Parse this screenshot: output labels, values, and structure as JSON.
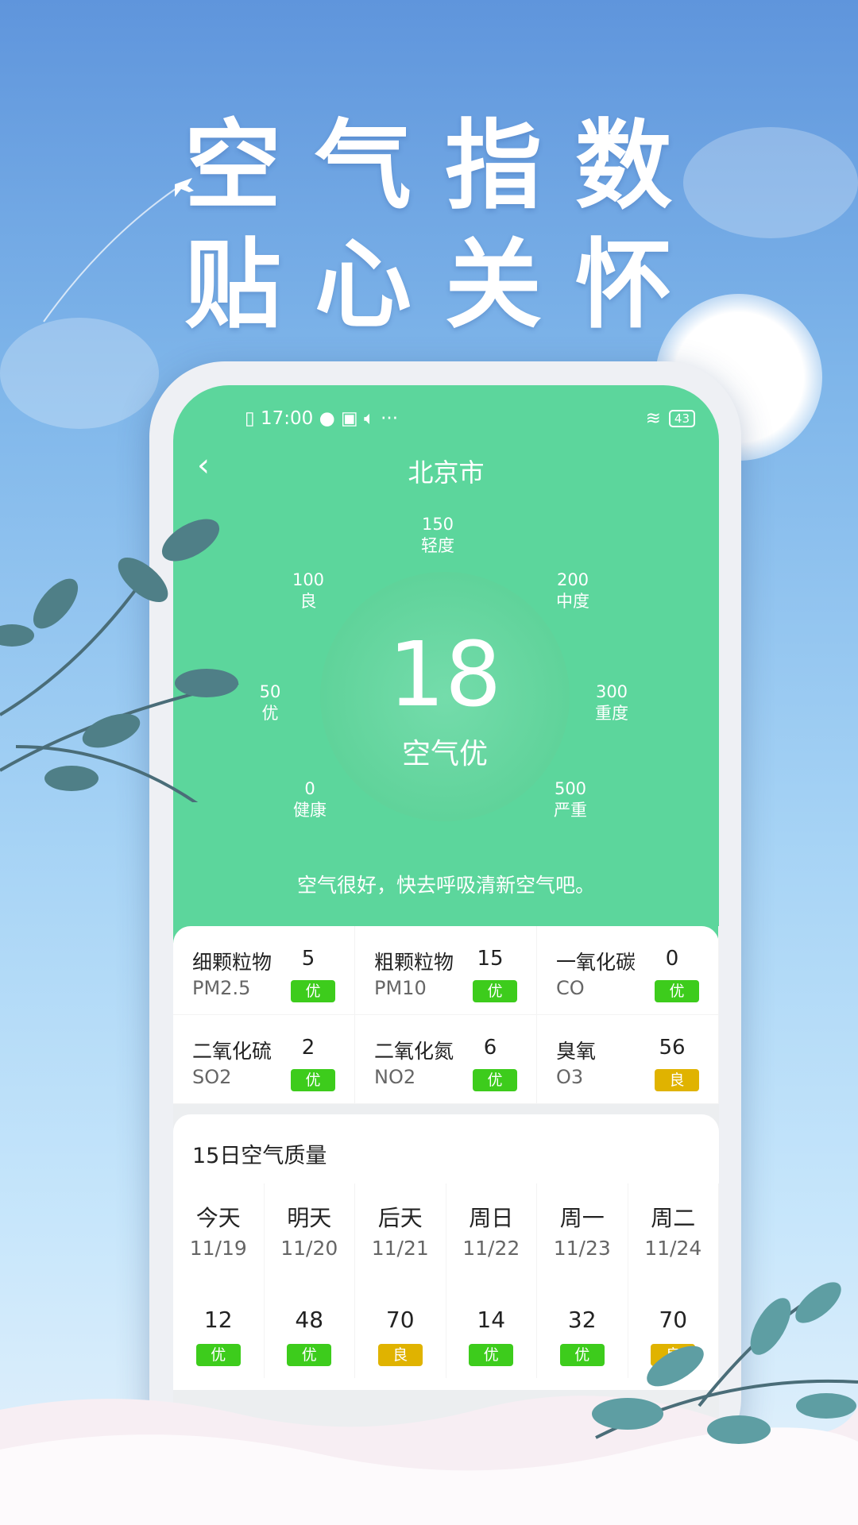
{
  "promo": {
    "line1": "空气指数",
    "line2": "贴心关怀"
  },
  "status_bar": {
    "time": "17:00",
    "battery": "43",
    "dots": "···"
  },
  "header": {
    "title": "北京市",
    "back_icon": "chevron-left-icon"
  },
  "gauge": {
    "aqi": "18",
    "label": "空气优",
    "ticks": [
      {
        "value": "0",
        "level": "健康"
      },
      {
        "value": "50",
        "level": "优"
      },
      {
        "value": "100",
        "level": "良"
      },
      {
        "value": "150",
        "level": "轻度"
      },
      {
        "value": "200",
        "level": "中度"
      },
      {
        "value": "300",
        "level": "重度"
      },
      {
        "value": "500",
        "level": "严重"
      }
    ]
  },
  "message": "空气很好，快去呼吸清新空气吧。",
  "colors": {
    "green_bg": "#5cd69c",
    "good_badge": "#3dcc1c",
    "moderate_badge": "#e0b300"
  },
  "pollutants": [
    {
      "name": "细颗粒物",
      "code": "PM2.5",
      "value": "5",
      "level": "优",
      "status": "good"
    },
    {
      "name": "粗颗粒物",
      "code": "PM10",
      "value": "15",
      "level": "优",
      "status": "good"
    },
    {
      "name": "一氧化碳",
      "code": "CO",
      "value": "0",
      "level": "优",
      "status": "good"
    },
    {
      "name": "二氧化硫",
      "code": "SO2",
      "value": "2",
      "level": "优",
      "status": "good"
    },
    {
      "name": "二氧化氮",
      "code": "NO2",
      "value": "6",
      "level": "优",
      "status": "good"
    },
    {
      "name": "臭氧",
      "code": "O3",
      "value": "56",
      "level": "良",
      "status": "moderate"
    }
  ],
  "forecast": {
    "title": "15日空气质量",
    "days": [
      {
        "day": "今天",
        "date": "11/19",
        "value": "12",
        "level": "优",
        "status": "good"
      },
      {
        "day": "明天",
        "date": "11/20",
        "value": "48",
        "level": "优",
        "status": "good"
      },
      {
        "day": "后天",
        "date": "11/21",
        "value": "70",
        "level": "良",
        "status": "moderate"
      },
      {
        "day": "周日",
        "date": "11/22",
        "value": "14",
        "level": "优",
        "status": "good"
      },
      {
        "day": "周一",
        "date": "11/23",
        "value": "32",
        "level": "优",
        "status": "good"
      },
      {
        "day": "周二",
        "date": "11/24",
        "value": "70",
        "level": "良",
        "status": "moderate"
      }
    ]
  }
}
